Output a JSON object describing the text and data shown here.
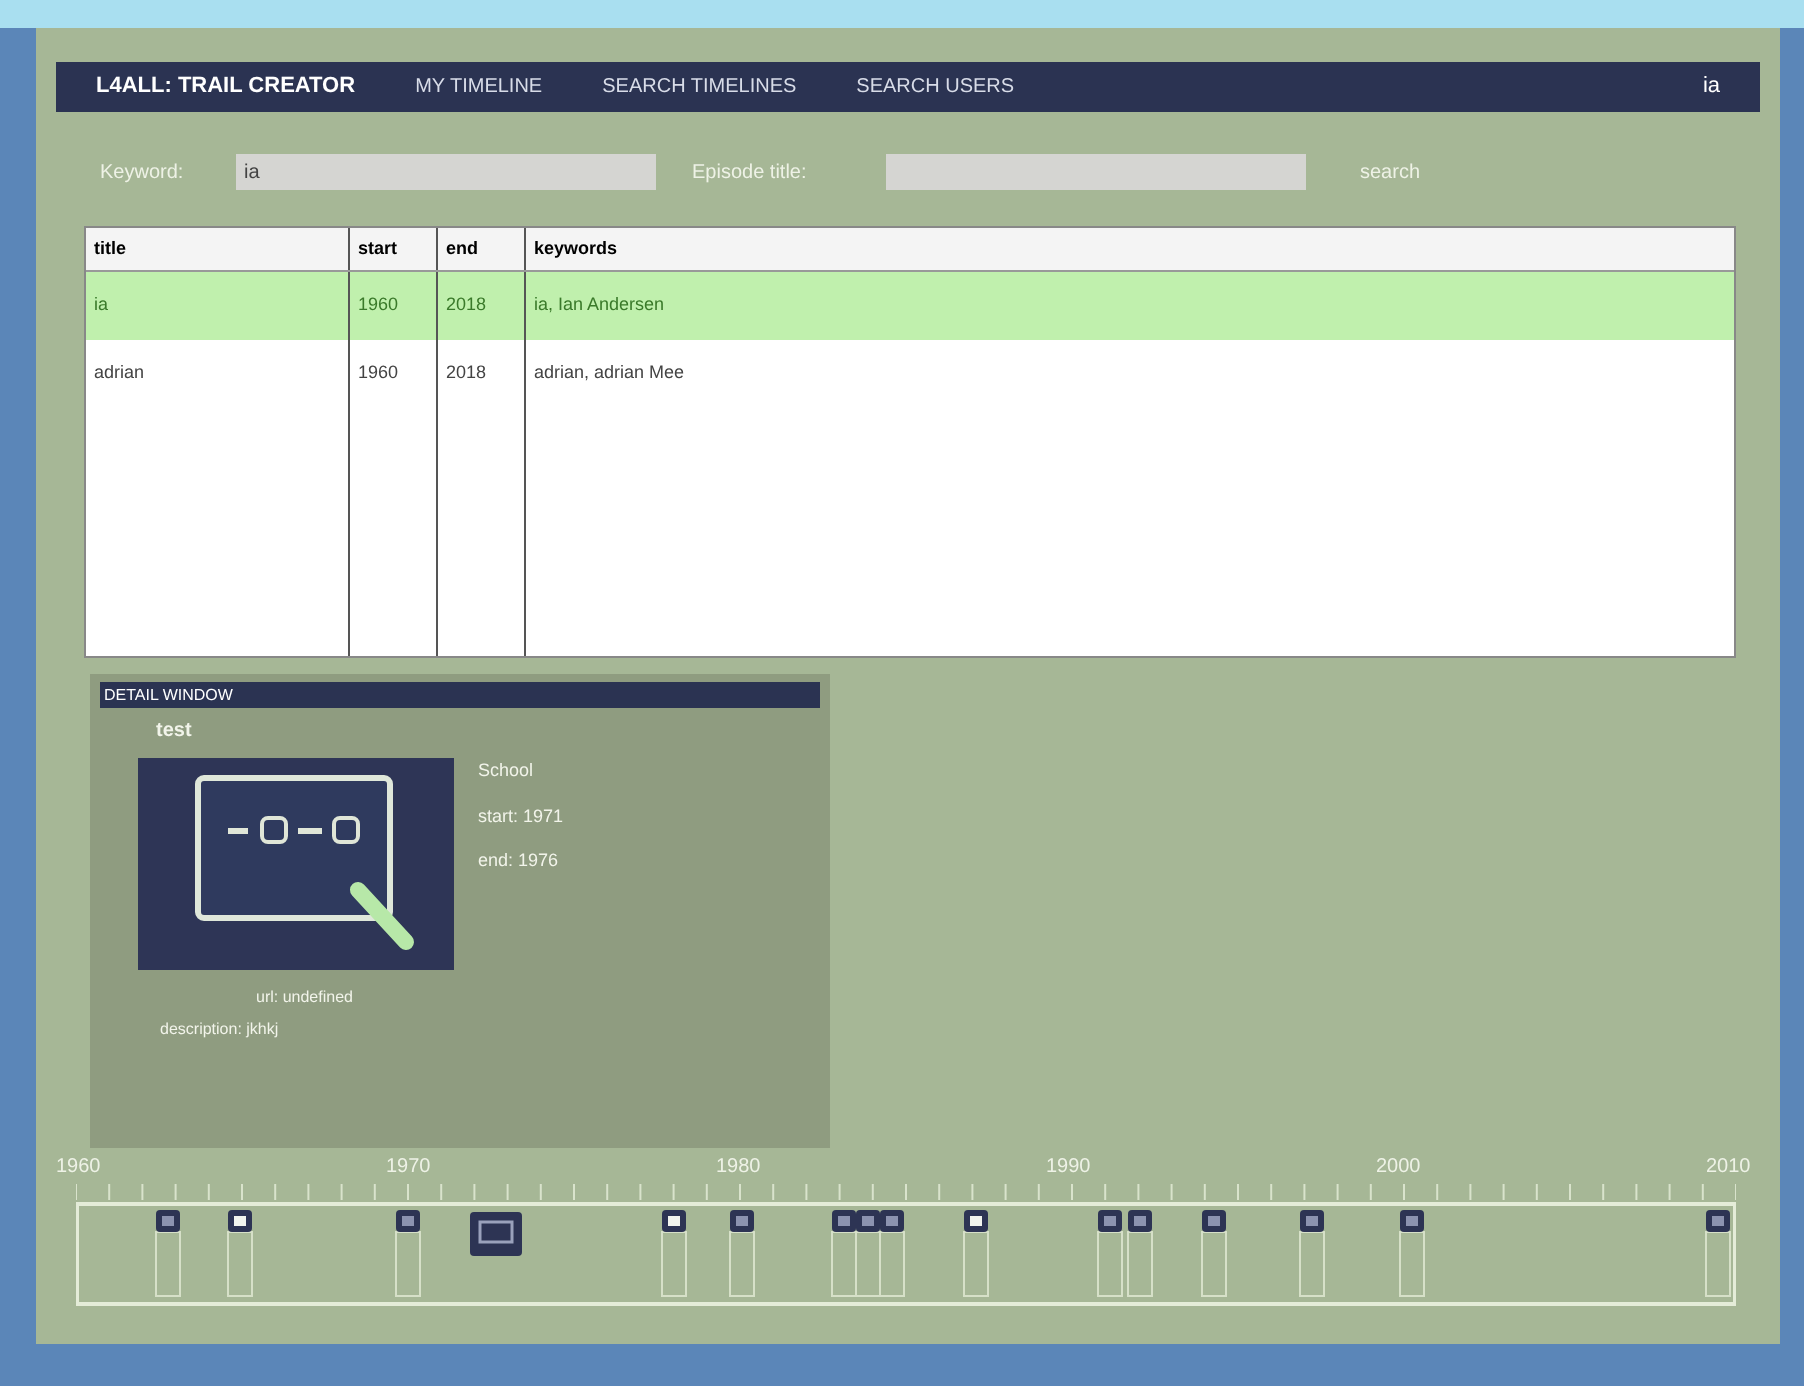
{
  "nav": {
    "brand": "L4ALL: TRAIL CREATOR",
    "items": [
      {
        "label": "MY TIMELINE"
      },
      {
        "label": "SEARCH TIMELINES"
      },
      {
        "label": "SEARCH USERS"
      }
    ],
    "user": "ia"
  },
  "search": {
    "keyword_label": "Keyword:",
    "keyword_value": "ia",
    "title_label": "Episode title:",
    "button": "search"
  },
  "table": {
    "columns": [
      "title",
      "start",
      "end",
      "keywords"
    ],
    "rows": [
      {
        "cells": [
          "ia",
          "1960",
          "2018",
          "ia, Ian Andersen"
        ],
        "selected": true
      },
      {
        "cells": [
          "adrian",
          "1960",
          "2018",
          "adrian, adrian Mee"
        ],
        "selected": false
      }
    ]
  },
  "detail": {
    "header": "DETAIL WINDOW",
    "title": "test",
    "category": "School",
    "start": "start: 1971",
    "end": "end: 1976",
    "url": "url: undefined",
    "description": "description: jkhkj"
  },
  "timeline": {
    "years": [
      "1960",
      "1970",
      "1980",
      "1990",
      "2000",
      "2010"
    ]
  }
}
